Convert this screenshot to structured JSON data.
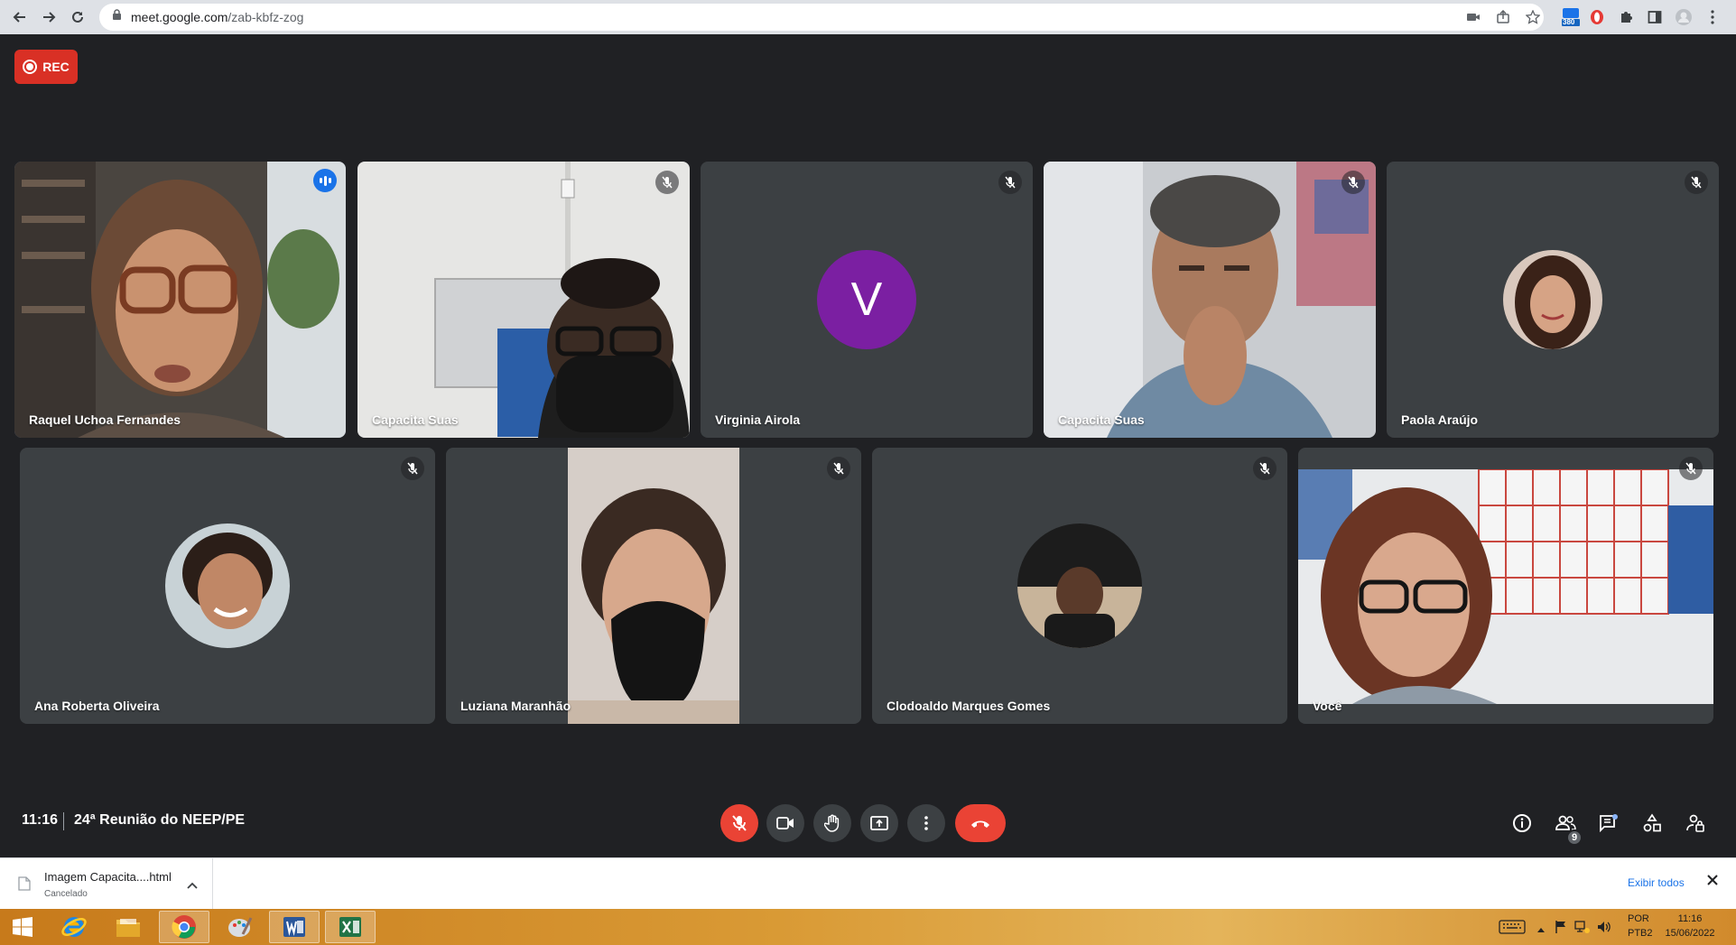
{
  "browser": {
    "url_host": "meet.google.com",
    "url_path": "/zab-kbfz-zog",
    "extension_badge": "380"
  },
  "meet": {
    "rec_label": "REC",
    "participants": [
      {
        "name": "Raquel Uchoa Fernandes",
        "state": "speaking"
      },
      {
        "name": "Capacita Suas",
        "state": "muted"
      },
      {
        "name": "Virginia Airola",
        "state": "muted",
        "avatar_letter": "V"
      },
      {
        "name": "Capacita Suas",
        "state": "muted"
      },
      {
        "name": "Paola Araújo",
        "state": "muted"
      },
      {
        "name": "Ana Roberta Oliveira",
        "state": "muted"
      },
      {
        "name": "Luziana Maranhão",
        "state": "muted"
      },
      {
        "name": "Clodoaldo Marques Gomes",
        "state": "muted"
      },
      {
        "name": "Você",
        "state": "muted"
      }
    ],
    "time": "11:16",
    "meeting_title": "24ª Reunião do NEEP/PE",
    "people_count": "9",
    "colors": {
      "background": "#202124",
      "tile": "#3c4043",
      "danger": "#ea4335",
      "speaking": "#8ab4f8",
      "rec": "#d93025"
    }
  },
  "downloads": {
    "file_name": "Imagem Capacita....html",
    "status": "Cancelado",
    "show_all": "Exibir todos"
  },
  "taskbar": {
    "lang_line1": "POR",
    "lang_line2": "PTB2",
    "time": "11:16",
    "date": "15/06/2022"
  }
}
